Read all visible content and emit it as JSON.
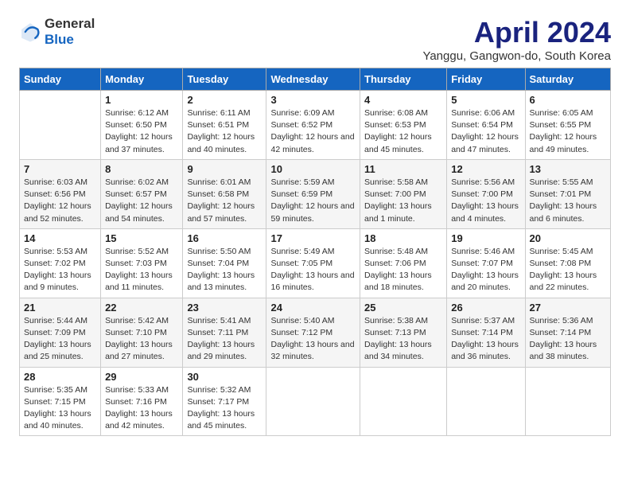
{
  "header": {
    "logo_general": "General",
    "logo_blue": "Blue",
    "title": "April 2024",
    "subtitle": "Yanggu, Gangwon-do, South Korea"
  },
  "days_of_week": [
    "Sunday",
    "Monday",
    "Tuesday",
    "Wednesday",
    "Thursday",
    "Friday",
    "Saturday"
  ],
  "weeks": [
    [
      {
        "day": "",
        "sunrise": "",
        "sunset": "",
        "daylight": ""
      },
      {
        "day": "1",
        "sunrise": "Sunrise: 6:12 AM",
        "sunset": "Sunset: 6:50 PM",
        "daylight": "Daylight: 12 hours and 37 minutes."
      },
      {
        "day": "2",
        "sunrise": "Sunrise: 6:11 AM",
        "sunset": "Sunset: 6:51 PM",
        "daylight": "Daylight: 12 hours and 40 minutes."
      },
      {
        "day": "3",
        "sunrise": "Sunrise: 6:09 AM",
        "sunset": "Sunset: 6:52 PM",
        "daylight": "Daylight: 12 hours and 42 minutes."
      },
      {
        "day": "4",
        "sunrise": "Sunrise: 6:08 AM",
        "sunset": "Sunset: 6:53 PM",
        "daylight": "Daylight: 12 hours and 45 minutes."
      },
      {
        "day": "5",
        "sunrise": "Sunrise: 6:06 AM",
        "sunset": "Sunset: 6:54 PM",
        "daylight": "Daylight: 12 hours and 47 minutes."
      },
      {
        "day": "6",
        "sunrise": "Sunrise: 6:05 AM",
        "sunset": "Sunset: 6:55 PM",
        "daylight": "Daylight: 12 hours and 49 minutes."
      }
    ],
    [
      {
        "day": "7",
        "sunrise": "Sunrise: 6:03 AM",
        "sunset": "Sunset: 6:56 PM",
        "daylight": "Daylight: 12 hours and 52 minutes."
      },
      {
        "day": "8",
        "sunrise": "Sunrise: 6:02 AM",
        "sunset": "Sunset: 6:57 PM",
        "daylight": "Daylight: 12 hours and 54 minutes."
      },
      {
        "day": "9",
        "sunrise": "Sunrise: 6:01 AM",
        "sunset": "Sunset: 6:58 PM",
        "daylight": "Daylight: 12 hours and 57 minutes."
      },
      {
        "day": "10",
        "sunrise": "Sunrise: 5:59 AM",
        "sunset": "Sunset: 6:59 PM",
        "daylight": "Daylight: 12 hours and 59 minutes."
      },
      {
        "day": "11",
        "sunrise": "Sunrise: 5:58 AM",
        "sunset": "Sunset: 7:00 PM",
        "daylight": "Daylight: 13 hours and 1 minute."
      },
      {
        "day": "12",
        "sunrise": "Sunrise: 5:56 AM",
        "sunset": "Sunset: 7:00 PM",
        "daylight": "Daylight: 13 hours and 4 minutes."
      },
      {
        "day": "13",
        "sunrise": "Sunrise: 5:55 AM",
        "sunset": "Sunset: 7:01 PM",
        "daylight": "Daylight: 13 hours and 6 minutes."
      }
    ],
    [
      {
        "day": "14",
        "sunrise": "Sunrise: 5:53 AM",
        "sunset": "Sunset: 7:02 PM",
        "daylight": "Daylight: 13 hours and 9 minutes."
      },
      {
        "day": "15",
        "sunrise": "Sunrise: 5:52 AM",
        "sunset": "Sunset: 7:03 PM",
        "daylight": "Daylight: 13 hours and 11 minutes."
      },
      {
        "day": "16",
        "sunrise": "Sunrise: 5:50 AM",
        "sunset": "Sunset: 7:04 PM",
        "daylight": "Daylight: 13 hours and 13 minutes."
      },
      {
        "day": "17",
        "sunrise": "Sunrise: 5:49 AM",
        "sunset": "Sunset: 7:05 PM",
        "daylight": "Daylight: 13 hours and 16 minutes."
      },
      {
        "day": "18",
        "sunrise": "Sunrise: 5:48 AM",
        "sunset": "Sunset: 7:06 PM",
        "daylight": "Daylight: 13 hours and 18 minutes."
      },
      {
        "day": "19",
        "sunrise": "Sunrise: 5:46 AM",
        "sunset": "Sunset: 7:07 PM",
        "daylight": "Daylight: 13 hours and 20 minutes."
      },
      {
        "day": "20",
        "sunrise": "Sunrise: 5:45 AM",
        "sunset": "Sunset: 7:08 PM",
        "daylight": "Daylight: 13 hours and 22 minutes."
      }
    ],
    [
      {
        "day": "21",
        "sunrise": "Sunrise: 5:44 AM",
        "sunset": "Sunset: 7:09 PM",
        "daylight": "Daylight: 13 hours and 25 minutes."
      },
      {
        "day": "22",
        "sunrise": "Sunrise: 5:42 AM",
        "sunset": "Sunset: 7:10 PM",
        "daylight": "Daylight: 13 hours and 27 minutes."
      },
      {
        "day": "23",
        "sunrise": "Sunrise: 5:41 AM",
        "sunset": "Sunset: 7:11 PM",
        "daylight": "Daylight: 13 hours and 29 minutes."
      },
      {
        "day": "24",
        "sunrise": "Sunrise: 5:40 AM",
        "sunset": "Sunset: 7:12 PM",
        "daylight": "Daylight: 13 hours and 32 minutes."
      },
      {
        "day": "25",
        "sunrise": "Sunrise: 5:38 AM",
        "sunset": "Sunset: 7:13 PM",
        "daylight": "Daylight: 13 hours and 34 minutes."
      },
      {
        "day": "26",
        "sunrise": "Sunrise: 5:37 AM",
        "sunset": "Sunset: 7:14 PM",
        "daylight": "Daylight: 13 hours and 36 minutes."
      },
      {
        "day": "27",
        "sunrise": "Sunrise: 5:36 AM",
        "sunset": "Sunset: 7:14 PM",
        "daylight": "Daylight: 13 hours and 38 minutes."
      }
    ],
    [
      {
        "day": "28",
        "sunrise": "Sunrise: 5:35 AM",
        "sunset": "Sunset: 7:15 PM",
        "daylight": "Daylight: 13 hours and 40 minutes."
      },
      {
        "day": "29",
        "sunrise": "Sunrise: 5:33 AM",
        "sunset": "Sunset: 7:16 PM",
        "daylight": "Daylight: 13 hours and 42 minutes."
      },
      {
        "day": "30",
        "sunrise": "Sunrise: 5:32 AM",
        "sunset": "Sunset: 7:17 PM",
        "daylight": "Daylight: 13 hours and 45 minutes."
      },
      {
        "day": "",
        "sunrise": "",
        "sunset": "",
        "daylight": ""
      },
      {
        "day": "",
        "sunrise": "",
        "sunset": "",
        "daylight": ""
      },
      {
        "day": "",
        "sunrise": "",
        "sunset": "",
        "daylight": ""
      },
      {
        "day": "",
        "sunrise": "",
        "sunset": "",
        "daylight": ""
      }
    ]
  ]
}
